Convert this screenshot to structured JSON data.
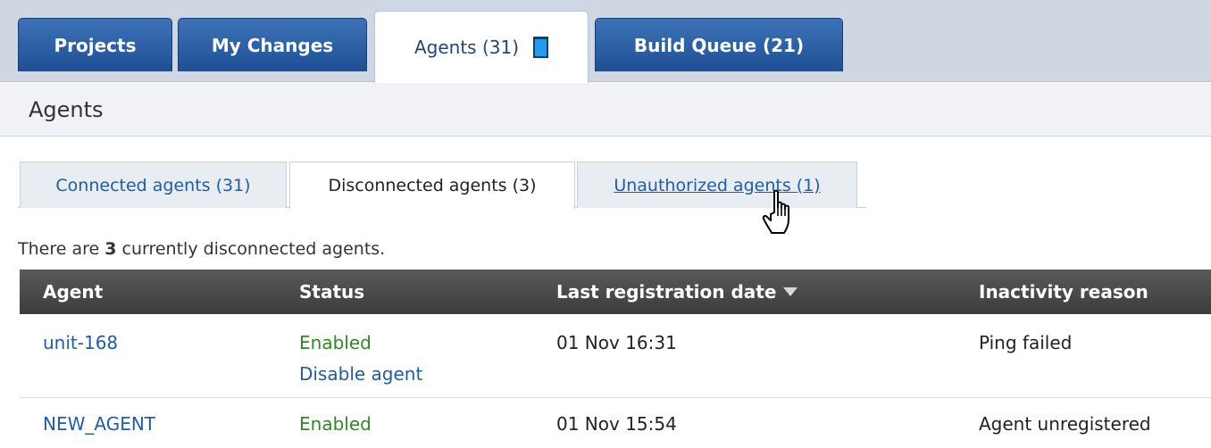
{
  "top_tabs": [
    {
      "label": "Projects",
      "active": false
    },
    {
      "label": "My Changes",
      "active": false
    },
    {
      "label": "Agents (31)",
      "active": true
    },
    {
      "label": "Build Queue (21)",
      "active": false
    }
  ],
  "section": {
    "title": "Agents"
  },
  "sub_tabs": [
    {
      "label": "Connected agents (31)"
    },
    {
      "label": "Disconnected agents (3)"
    },
    {
      "label": "Unauthorized agents (1)"
    }
  ],
  "info": {
    "prefix": "There are ",
    "count": "3",
    "suffix": " currently disconnected agents."
  },
  "table": {
    "columns": [
      "Agent",
      "Status",
      "Last registration date",
      "Inactivity reason"
    ],
    "rows": [
      {
        "agent": "unit-168",
        "status": "Enabled",
        "action": "Disable agent",
        "date": "01 Nov 16:31",
        "reason": "Ping failed"
      },
      {
        "agent": "NEW_AGENT",
        "status": "Enabled",
        "date": "01 Nov 15:54",
        "reason": "Agent unregistered"
      }
    ]
  },
  "colors": {
    "tab_blue": "#1f4f95",
    "link": "#1f5cac",
    "enabled": "#2e8b22",
    "header_dark": "#3c3c3c"
  }
}
